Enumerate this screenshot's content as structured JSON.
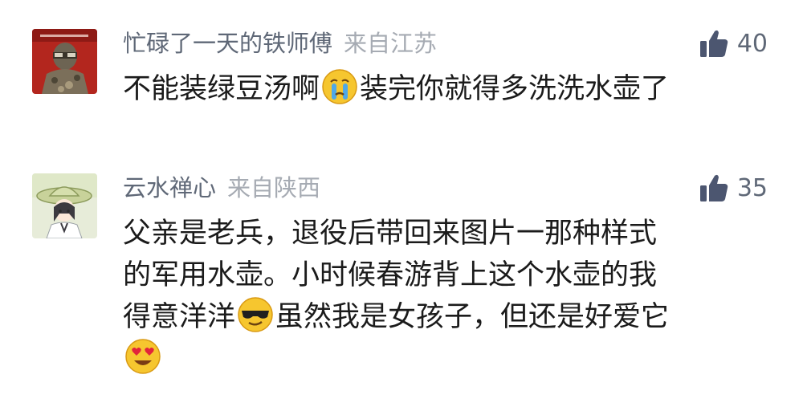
{
  "comments": [
    {
      "username": "忙碌了一天的铁师傅",
      "location": "来自江苏",
      "likes": "40",
      "avatar_icon": "avatar-camo-person",
      "content": {
        "line1_a": "不能装绿豆汤啊",
        "emoji1": "crying-face-emoji",
        "line1_b": "装完你就得多洗洗水壶了"
      }
    },
    {
      "username": "云水禅心",
      "location": "来自陕西",
      "likes": "35",
      "avatar_icon": "avatar-straw-hat-girl",
      "content": {
        "line1": "父亲是老兵，退役后带回来图片一那种样式",
        "line2": "的军用水壶。小时候春游背上这个水壶的我",
        "line3_a": "得意洋洋",
        "emoji1": "sunglasses-face-emoji",
        "line3_b": "虽然我是女孩子，但还是好爱它",
        "emoji2": "heart-eyes-emoji"
      }
    }
  ],
  "colors": {
    "username": "#5f6877",
    "location": "#a6abb3",
    "like_icon": "#4c5670",
    "content_text": "#1b1b1b"
  }
}
